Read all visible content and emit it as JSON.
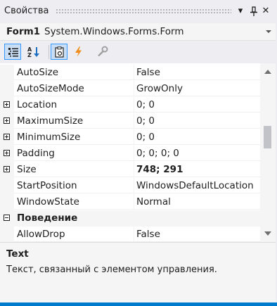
{
  "window": {
    "title": "Свойства",
    "dropdown_glyph": "▾",
    "pin_glyph": "⊥",
    "close_glyph": "✕"
  },
  "object_selector": {
    "name": "Form1",
    "type": "System.Windows.Forms.Form"
  },
  "toolbar": {
    "buttons": [
      {
        "icon": "categorized-icon",
        "active": true
      },
      {
        "icon": "alphabetical-sort-icon",
        "active": false
      },
      {
        "icon": "properties-icon",
        "active": true
      },
      {
        "icon": "events-lightning-icon",
        "active": false
      },
      {
        "icon": "property-pages-wrench-icon",
        "active": false
      }
    ]
  },
  "properties": {
    "rows": [
      {
        "name": "AutoSize",
        "value": "False",
        "expandable": false,
        "bold": false
      },
      {
        "name": "AutoSizeMode",
        "value": "GrowOnly",
        "expandable": false,
        "bold": false
      },
      {
        "name": "Location",
        "value": "0; 0",
        "expandable": true,
        "bold": false
      },
      {
        "name": "MaximumSize",
        "value": "0; 0",
        "expandable": true,
        "bold": false
      },
      {
        "name": "MinimumSize",
        "value": "0; 0",
        "expandable": true,
        "bold": false
      },
      {
        "name": "Padding",
        "value": "0; 0; 0; 0",
        "expandable": true,
        "bold": false
      },
      {
        "name": "Size",
        "value": "748; 291",
        "expandable": true,
        "bold": true
      },
      {
        "name": "StartPosition",
        "value": "WindowsDefaultLocation",
        "expandable": false,
        "bold": false
      },
      {
        "name": "WindowState",
        "value": "Normal",
        "expandable": false,
        "bold": false
      }
    ],
    "category": {
      "name": "Поведение",
      "expanded": true
    },
    "after_category": [
      {
        "name": "AllowDrop",
        "value": "False"
      }
    ]
  },
  "description": {
    "title": "Text",
    "text": "Текст, связанный с элементом управления."
  },
  "colors": {
    "accent": "#007acc",
    "chrome": "#eeeef2",
    "selected_button": "#c9def5",
    "lightning": "#f28c1c"
  }
}
